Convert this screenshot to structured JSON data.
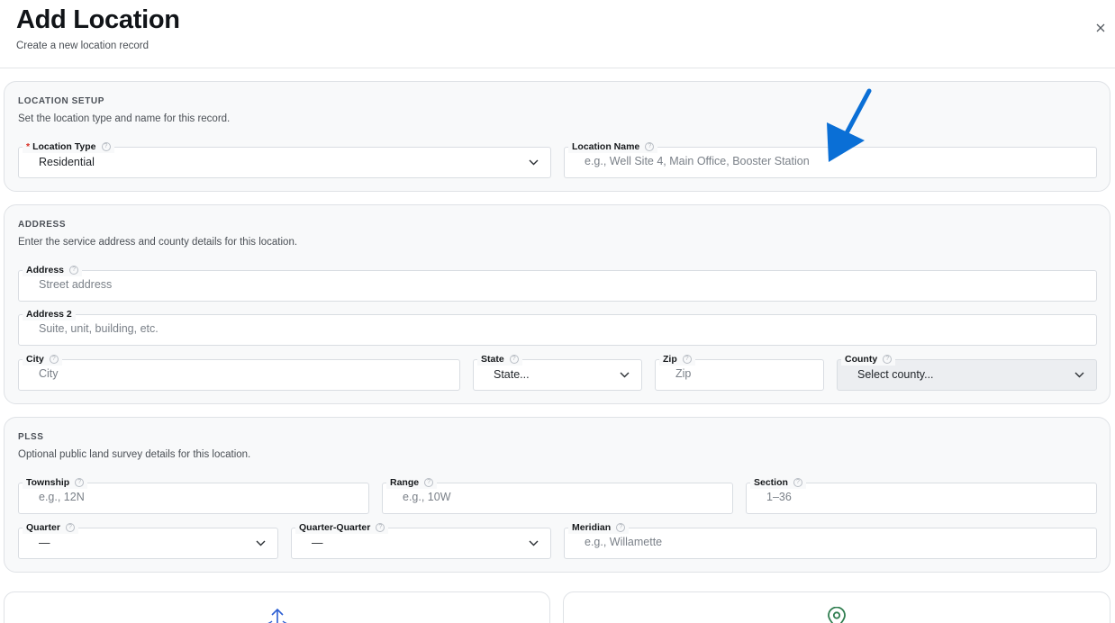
{
  "header": {
    "title": "Add Location",
    "subtitle": "Create a new location record"
  },
  "sections": {
    "setup": {
      "title": "LOCATION SETUP",
      "description": "Set the location type and name for this record.",
      "location_type": {
        "label": "Location Type",
        "required": true,
        "value": "Residential"
      },
      "location_name": {
        "label": "Location Name",
        "placeholder": "e.g., Well Site 4, Main Office, Booster Station"
      }
    },
    "address": {
      "title": "ADDRESS",
      "description": "Enter the service address and county details for this location.",
      "address": {
        "label": "Address",
        "placeholder": "Street address"
      },
      "address2": {
        "label": "Address 2",
        "placeholder": "Suite, unit, building, etc."
      },
      "city": {
        "label": "City",
        "placeholder": "City"
      },
      "state": {
        "label": "State",
        "value": "State..."
      },
      "zip": {
        "label": "Zip",
        "placeholder": "Zip"
      },
      "county": {
        "label": "County",
        "value": "Select county..."
      }
    },
    "plss": {
      "title": "PLSS",
      "description": "Optional public land survey details for this location.",
      "township": {
        "label": "Township",
        "placeholder": "e.g., 12N"
      },
      "range": {
        "label": "Range",
        "placeholder": "e.g., 10W"
      },
      "section": {
        "label": "Section",
        "placeholder": "1–36"
      },
      "quarter": {
        "label": "Quarter",
        "value": "—"
      },
      "quarter_quarter": {
        "label": "Quarter-Quarter",
        "value": "—"
      },
      "meridian": {
        "label": "Meridian",
        "placeholder": "e.g., Willamette"
      }
    }
  },
  "icons": {
    "close": "close-icon",
    "help": "help-circle-icon",
    "chevron": "chevron-down-icon",
    "upload": "upload-arrow-icon",
    "map_pin": "map-pin-icon"
  },
  "colors": {
    "annotation_arrow": "#0a6fd6",
    "required": "#d93025",
    "map_pin": "#2f7d4f",
    "upload": "#2d5fd3"
  }
}
